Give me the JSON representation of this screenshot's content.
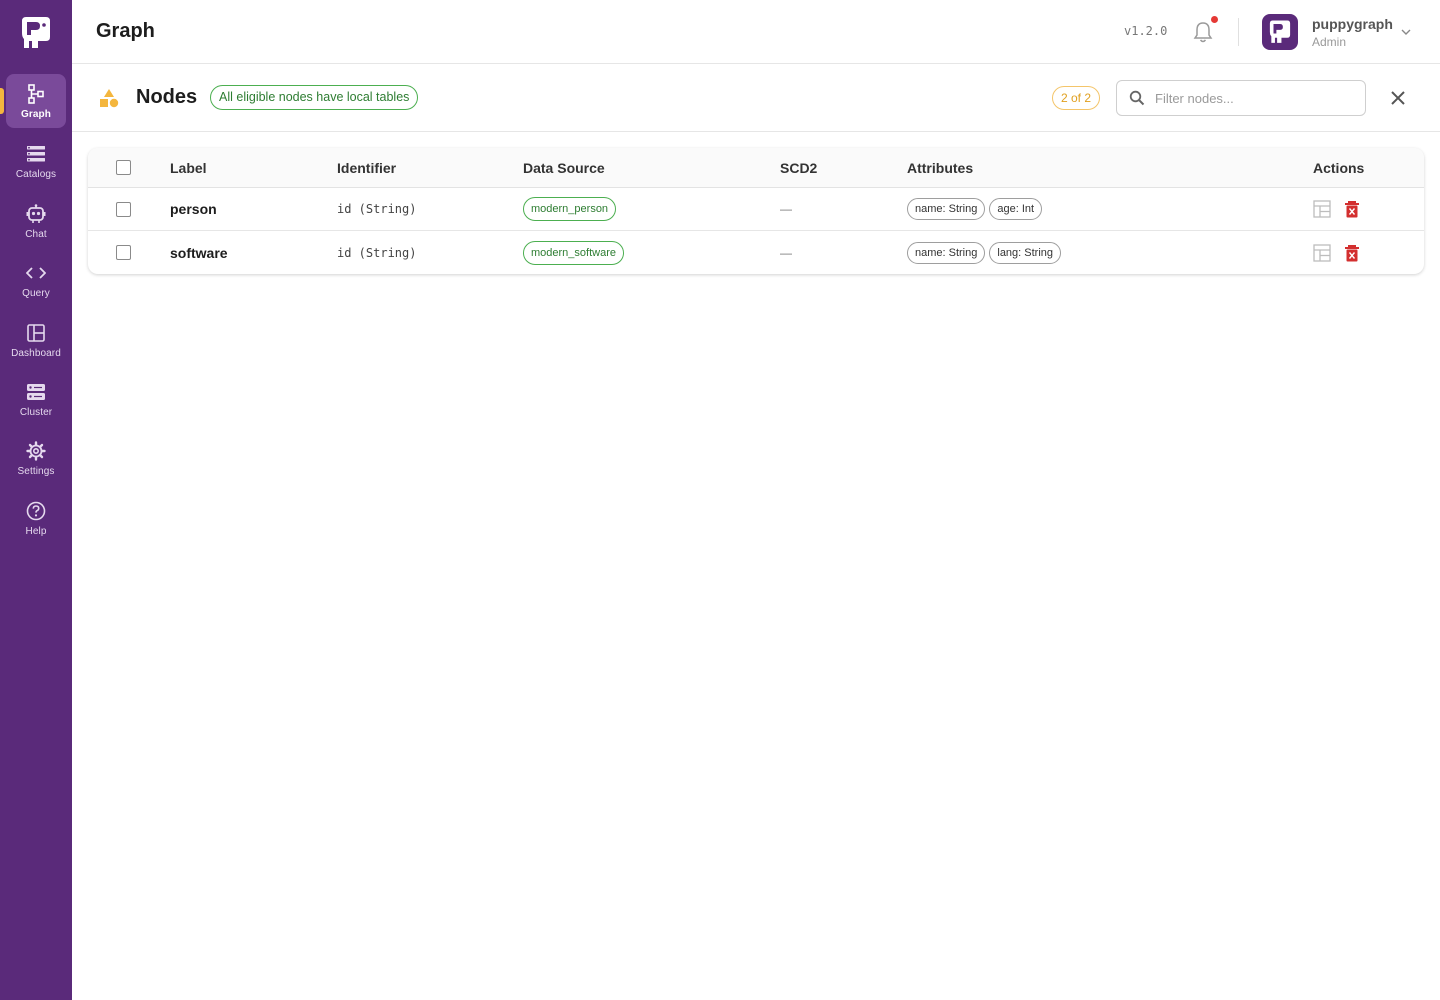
{
  "colors": {
    "sidebar": "#5a2a7a",
    "sidebar_active": "#7a4a9a",
    "accent_marker": "#f4b63e",
    "green": "#2e7d32",
    "amber": "#e0a020",
    "delete_red": "#d32f2f"
  },
  "sidebar": {
    "logo_icon": "puppygraph-logo-icon",
    "items": [
      {
        "label": "Graph",
        "icon": "graph-icon",
        "active": true
      },
      {
        "label": "Catalogs",
        "icon": "catalogs-icon",
        "active": false
      },
      {
        "label": "Chat",
        "icon": "chat-bot-icon",
        "active": false
      },
      {
        "label": "Query",
        "icon": "code-icon",
        "active": false
      },
      {
        "label": "Dashboard",
        "icon": "dashboard-icon",
        "active": false
      },
      {
        "label": "Cluster",
        "icon": "cluster-icon",
        "active": false
      },
      {
        "label": "Settings",
        "icon": "gear-icon",
        "active": false
      },
      {
        "label": "Help",
        "icon": "help-icon",
        "active": false
      }
    ]
  },
  "header": {
    "title": "Graph",
    "version": "v1.2.0",
    "has_notification": true,
    "user": {
      "name": "puppygraph",
      "role": "Admin"
    }
  },
  "panel": {
    "title": "Nodes",
    "status_badge": "All eligible nodes have local tables",
    "count_badge": "2 of 2",
    "search_placeholder": "Filter nodes...",
    "search_value": ""
  },
  "table": {
    "columns": [
      "Label",
      "Identifier",
      "Data Source",
      "SCD2",
      "Attributes",
      "Actions"
    ],
    "rows": [
      {
        "label": "person",
        "identifier": "id (String)",
        "data_source": "modern_person",
        "scd2": "—",
        "attributes": [
          "name: String",
          "age: Int"
        ]
      },
      {
        "label": "software",
        "identifier": "id (String)",
        "data_source": "modern_software",
        "scd2": "—",
        "attributes": [
          "name: String",
          "lang: String"
        ]
      }
    ]
  }
}
